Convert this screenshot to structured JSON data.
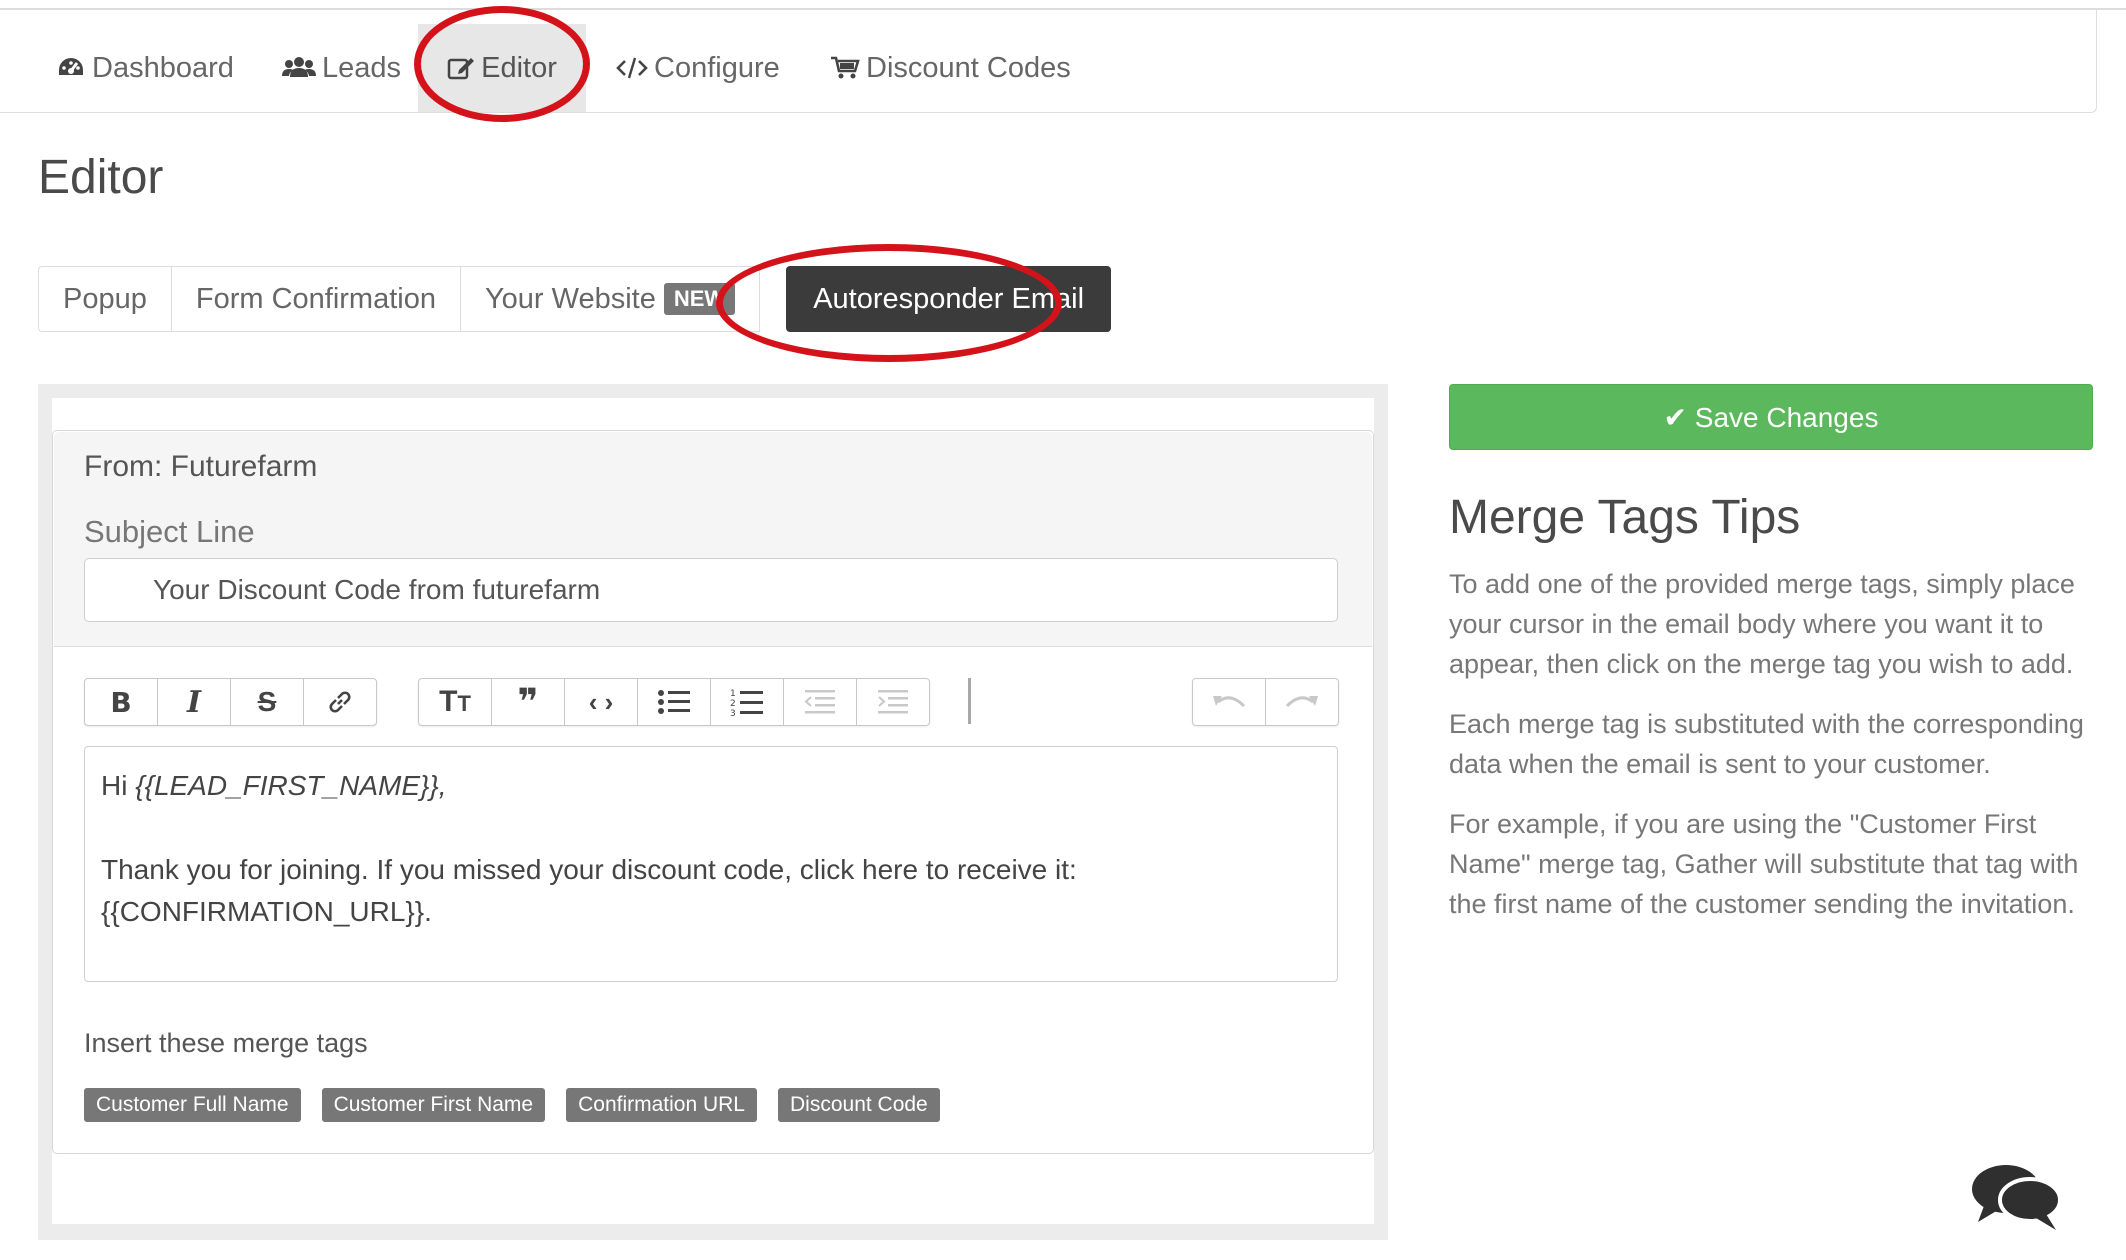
{
  "nav": {
    "items": [
      {
        "label": "Dashboard",
        "icon": "dashboard-icon"
      },
      {
        "label": "Leads",
        "icon": "users-icon"
      },
      {
        "label": "Editor",
        "icon": "edit-icon",
        "active": true
      },
      {
        "label": "Configure",
        "icon": "code-icon"
      },
      {
        "label": "Discount Codes",
        "icon": "cart-icon"
      }
    ]
  },
  "page": {
    "title": "Editor"
  },
  "tabs": {
    "popup": "Popup",
    "form_confirmation": "Form Confirmation",
    "your_website": "Your Website",
    "new_badge": "NEW",
    "autoresponder": "Autoresponder Email"
  },
  "email": {
    "from": "From: Futurefarm",
    "subject_label": "Subject Line",
    "subject_value": "Your Discount Code from futurefarm",
    "body": {
      "greeting": "Hi ",
      "first_name_tag": "{{LEAD_FIRST_NAME}},",
      "line2": "Thank you for joining. If you missed your discount code, click here to receive it:",
      "line3": "{{CONFIRMATION_URL}}."
    }
  },
  "toolbar": {
    "buttons": [
      "bold-icon",
      "italic-icon",
      "strikethrough-icon",
      "link-icon",
      "heading-icon",
      "quote-icon",
      "code-icon",
      "bullet-list-icon",
      "numbered-list-icon",
      "outdent-icon",
      "indent-icon",
      "undo-icon",
      "redo-icon"
    ]
  },
  "merge": {
    "label": "Insert these merge tags",
    "tags": [
      "Customer Full Name",
      "Customer First Name",
      "Confirmation URL",
      "Discount Code"
    ]
  },
  "save": {
    "label": "✔ Save Changes"
  },
  "tips": {
    "title": "Merge Tags Tips",
    "p1": "To add one of the provided merge tags, simply place your cursor in the email body where you want it to appear, then click on the merge tag you wish to add.",
    "p2": "Each merge tag is substituted with the corresponding data when the email is sent to your customer.",
    "p3": "For example, if you are using the \"Customer First Name\" merge tag, Gather will substitute that tag with the first name of the customer sending the invitation."
  },
  "colors": {
    "accent_ring": "#d4121a",
    "save_green": "#5cb85c",
    "active_tab": "#3b3b3b"
  }
}
